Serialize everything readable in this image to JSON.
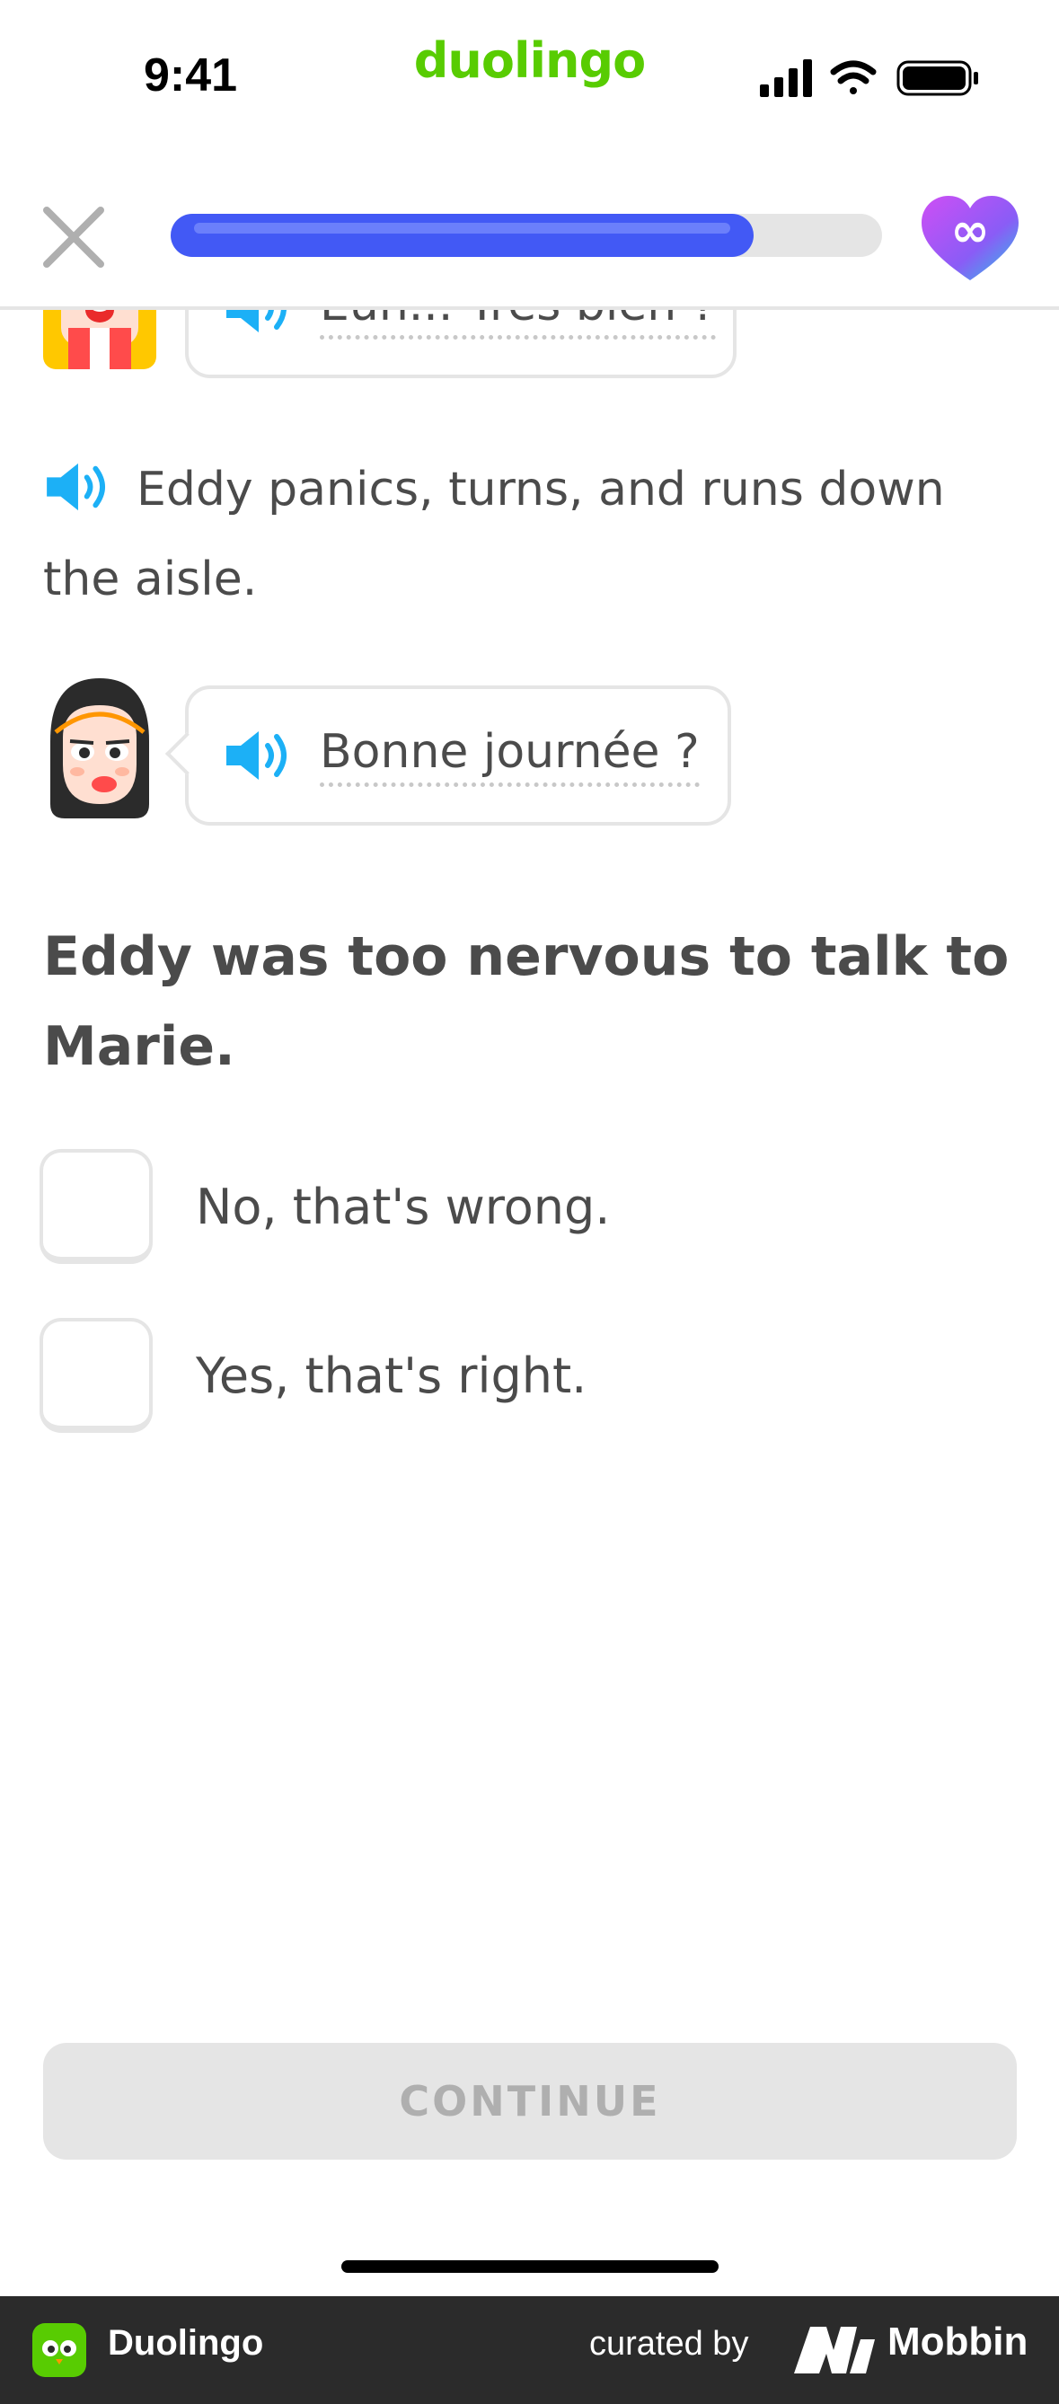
{
  "status_bar": {
    "time": "9:41",
    "brand": "duolingo"
  },
  "lesson": {
    "progress_fraction": 0.82,
    "hearts_label": "∞"
  },
  "story": {
    "bubble_top_text": "Euh... Très bien ?",
    "narration": "Eddy panics, turns, and runs down the aisle.",
    "bubble_marie_text": "Bonne journée ?"
  },
  "question": {
    "prompt": "Eddy was too nervous to talk to Marie.",
    "choices": [
      {
        "label": "No, that's wrong."
      },
      {
        "label": "Yes, that's right."
      }
    ]
  },
  "actions": {
    "continue_label": "CONTINUE"
  },
  "footer": {
    "app_name": "Duolingo",
    "curated_by": "curated by",
    "brand": "Mobbin"
  },
  "colors": {
    "brand_green": "#58cc02",
    "progress_blue": "#4259f5",
    "speaker_blue": "#1cb0f6",
    "border_gray": "#e5e5e5",
    "text_gray": "#4b4b4b"
  }
}
